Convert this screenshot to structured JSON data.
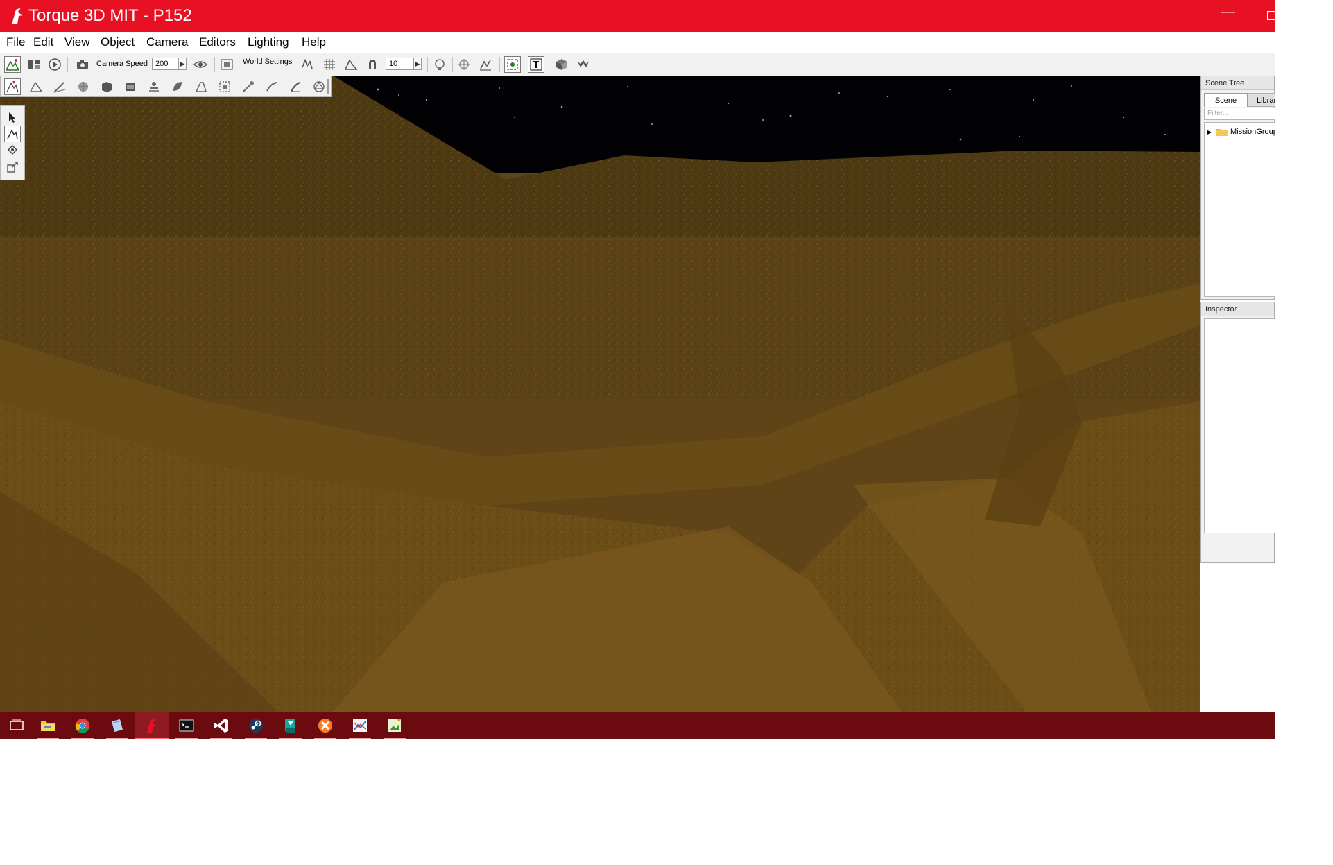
{
  "window": {
    "title": "Torque 3D MIT - P152",
    "minimize_glyph": "—"
  },
  "menu": {
    "items": [
      "File",
      "Edit",
      "View",
      "Object",
      "Camera",
      "Editors",
      "Lighting",
      "Help"
    ]
  },
  "toolbar": {
    "camera_speed_label": "Camera Speed",
    "camera_speed_value": "200",
    "world_settings_label": "World Settings",
    "snap_value": "10",
    "spin_arrow": "▶"
  },
  "scene_tree": {
    "title": "Scene Tree",
    "tabs": {
      "scene": "Scene",
      "library": "Library"
    },
    "filter_placeholder": "Filter...",
    "items": [
      {
        "label": "MissionGroup",
        "expand_glyph": "▶"
      }
    ]
  },
  "inspector": {
    "title": "Inspector"
  },
  "taskbar": {
    "items": [
      "task-view-icon",
      "file-explorer-icon",
      "chrome-icon",
      "notes-app-icon",
      "torque-icon",
      "terminal-icon",
      "visual-studio-icon",
      "steam-icon",
      "tool-app-icon",
      "xampp-icon",
      "chart-app-icon",
      "image-editor-icon"
    ]
  },
  "colors": {
    "titlebar": "#e81123",
    "taskbar": "#6b0a0f",
    "sky": "#020204",
    "terrain": "#5e4416"
  }
}
